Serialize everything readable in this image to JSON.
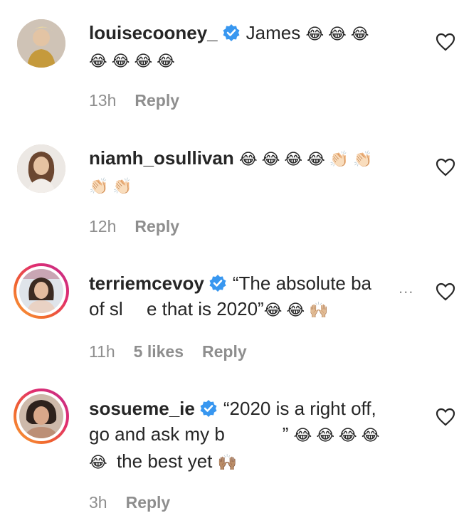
{
  "comments": [
    {
      "username": "louisecooney_",
      "verified": true,
      "text": "James",
      "emojis": [
        "😂",
        "😂",
        "😂",
        "😂",
        "😂",
        "😂",
        "😂"
      ],
      "time": "13h",
      "likes": "",
      "reply": "Reply"
    },
    {
      "username": "niamh_osullivan",
      "verified": false,
      "text": "",
      "emojis": [
        "😂",
        "😂",
        "😂",
        "😂",
        "👏🏻",
        "👏🏻",
        "👏🏻",
        "👏🏻"
      ],
      "time": "12h",
      "likes": "",
      "reply": "Reply"
    },
    {
      "username": "terriemcevoy",
      "verified": true,
      "text_line1": "“The absolute ba",
      "text_line2a": "of sl",
      "text_line2b": "e that is 2020”",
      "emojis": [
        "😂",
        "😂",
        "🙌🏼"
      ],
      "more": "...",
      "time": "11h",
      "likes": "5 likes",
      "reply": "Reply"
    },
    {
      "username": "sosueme_ie",
      "verified": true,
      "text_line1": "“2020 is a right off,",
      "text_line2": "go and ask my b",
      "text_line2_end": "”",
      "emojis_line2": [
        "😂",
        "😂",
        "😂",
        "😂"
      ],
      "emoji_line3": "😂",
      "text_line3": "the best yet",
      "emoji_line3_end": "🙌🏽",
      "time": "3h",
      "likes": "",
      "reply": "Reply"
    }
  ],
  "colors": {
    "verified": "#3897f0",
    "meta": "#8e8e8e",
    "text": "#262626"
  },
  "icons": {
    "like": "heart-outline-icon",
    "verified": "verified-badge-icon"
  }
}
